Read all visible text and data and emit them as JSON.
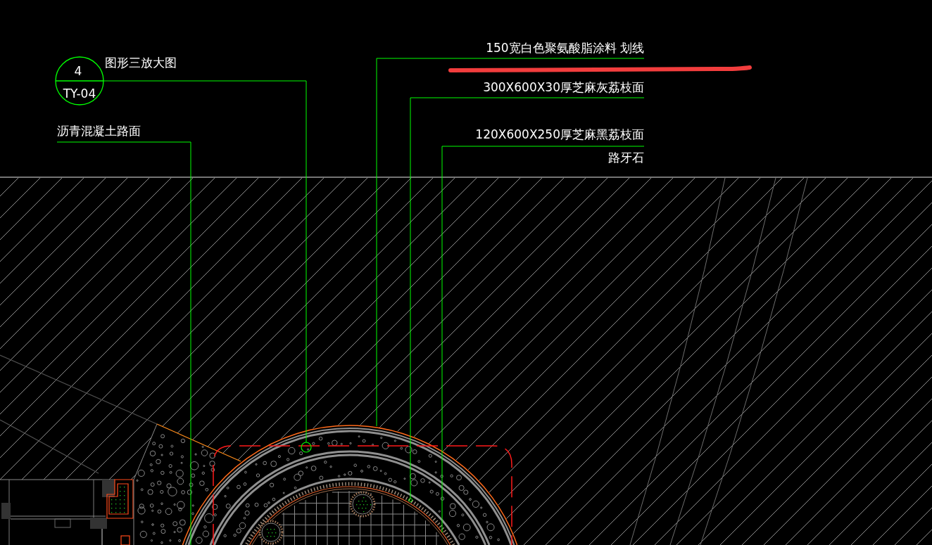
{
  "detail_callout": {
    "number": "4",
    "sheet": "TY-04",
    "title": "图形三放大图"
  },
  "leaders": [
    {
      "above": "150宽白色聚氨酸脂涂料 划线"
    },
    {
      "above": "300X600X30厚芝麻灰荔枝面"
    },
    {
      "above": "沥青混凝土路面"
    },
    {
      "above": "120X600X250厚芝麻黑荔枝面",
      "below": "路牙石"
    }
  ]
}
